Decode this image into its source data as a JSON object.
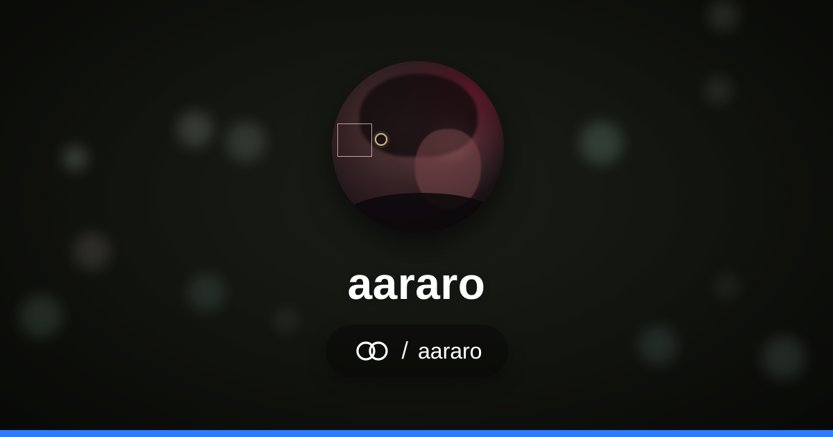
{
  "profile": {
    "name": "aararo",
    "handle": "aararo",
    "separator": "/",
    "avatar_icon": "profile-photo"
  },
  "brand": {
    "logo_icon": "linked-rings-logo-icon",
    "accent_color": "#2f7bff"
  }
}
